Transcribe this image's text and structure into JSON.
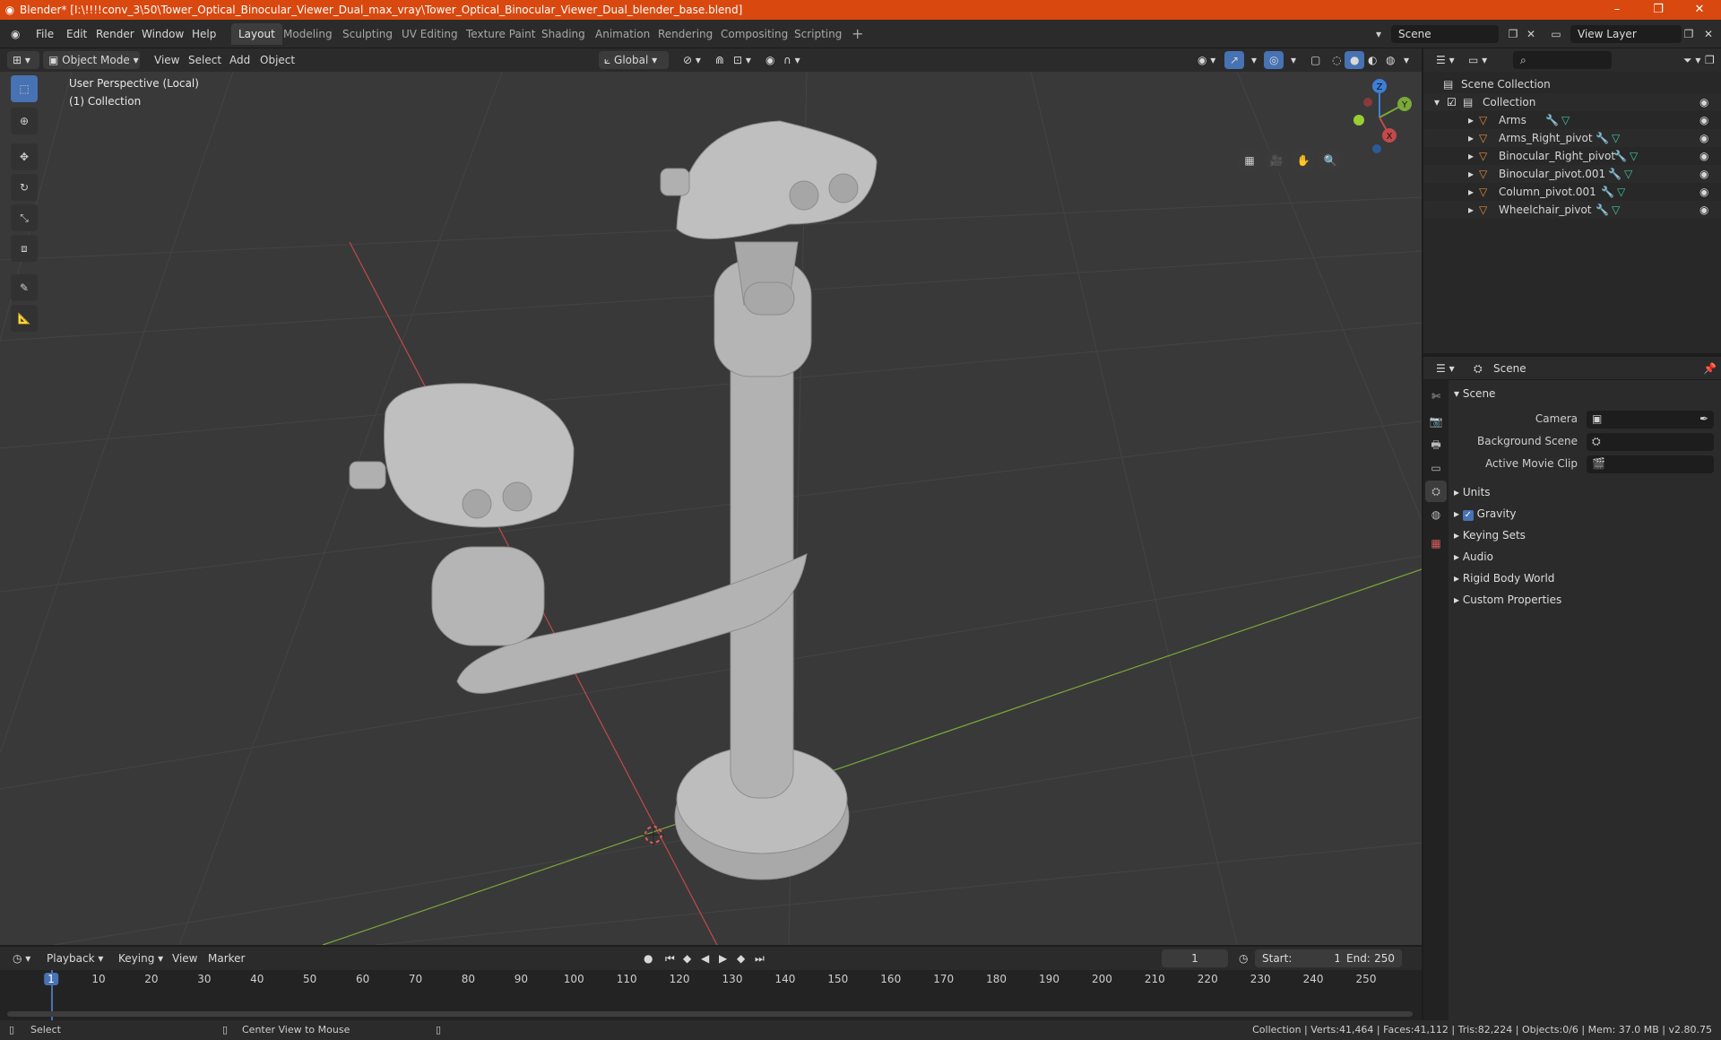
{
  "window": {
    "title": "Blender* [I:\\!!!!conv_3\\50\\Tower_Optical_Binocular_Viewer_Dual_max_vray\\Tower_Optical_Binocular_Viewer_Dual_blender_base.blend]",
    "minimize": "–",
    "maximize": "❐",
    "close": "✕"
  },
  "menu": {
    "items": [
      "File",
      "Edit",
      "Render",
      "Window",
      "Help"
    ]
  },
  "workspaces": [
    "Layout",
    "Modeling",
    "Sculpting",
    "UV Editing",
    "Texture Paint",
    "Shading",
    "Animation",
    "Rendering",
    "Compositing",
    "Scripting"
  ],
  "scene_selector": "Scene",
  "view_layer": "View Layer",
  "viewport_header": {
    "mode": "Object Mode",
    "menus": [
      "View",
      "Select",
      "Add",
      "Object"
    ],
    "transform_orientation": "Global"
  },
  "viewport": {
    "perspective_label": "User Perspective (Local)",
    "collection_label": "(1) Collection",
    "gizmo": {
      "z": "Z",
      "y": "Y",
      "x": "X"
    }
  },
  "outliner": {
    "root": "Scene Collection",
    "collection": "Collection",
    "objects": [
      "Arms",
      "Arms_Right_pivot",
      "Binocular_Right_pivot",
      "Binocular_pivot.001",
      "Column_pivot.001",
      "Wheelchair_pivot"
    ]
  },
  "properties": {
    "header": "Scene",
    "section": "Scene",
    "fields": [
      "Camera",
      "Background Scene",
      "Active Movie Clip"
    ],
    "subpanels": [
      "Units",
      "Gravity",
      "Keying Sets",
      "Audio",
      "Rigid Body World",
      "Custom Properties"
    ],
    "gravity_checked": true
  },
  "timeline": {
    "menus": [
      "Playback",
      "Keying",
      "View",
      "Marker"
    ],
    "current_frame": "1",
    "start_label": "Start:",
    "start": "1",
    "end_label": "End:",
    "end": "250",
    "ruler": [
      "1",
      "10",
      "20",
      "30",
      "40",
      "50",
      "60",
      "70",
      "80",
      "90",
      "100",
      "110",
      "120",
      "130",
      "140",
      "150",
      "160",
      "170",
      "180",
      "190",
      "200",
      "210",
      "220",
      "230",
      "240",
      "250"
    ]
  },
  "status": {
    "left": "Select",
    "middle": "Center View to Mouse",
    "right": "Collection | Verts:41,464 | Faces:41,112 | Tris:82,224 | Objects:0/6 | Mem: 37.0 MB | v2.80.75"
  },
  "colors": {
    "titlebar": "#d9480f",
    "accent": "#4772b3",
    "x_axis": "#c24a4a",
    "y_axis": "#7aa83a",
    "z_axis": "#3d7fd9",
    "object_icon": "#e08a3c",
    "modifier_icon": "#6aaee8",
    "mesh_icon": "#3fc7a0"
  }
}
